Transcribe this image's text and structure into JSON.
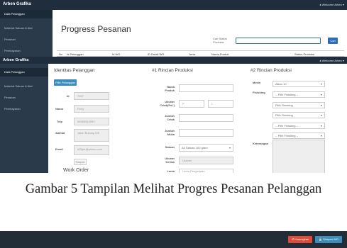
{
  "back": {
    "brand": "Arben Grafika",
    "welcome": "Welcome Arben",
    "sidebar": [
      "Data Pelanggan",
      "Material Satuan & Alat",
      "Pesanan",
      "Pembayaran"
    ],
    "title": "Progress Pesanan",
    "search_label": "Cari Status Produksi",
    "search_value": "",
    "cari": "Cari",
    "columns": [
      "No",
      "Id Pelanggan",
      "Id WO",
      "ID Detail WO",
      "Jenis",
      "Nama Produk",
      "Status Produksi"
    ]
  },
  "front": {
    "brand": "Arben Grafika",
    "welcome": "Welcome Arben",
    "sidebar": [
      "Data Pelanggan",
      "Material Satuan & Alat",
      "Pesanan",
      "Pembayaran"
    ],
    "identitas": {
      "title": "Identitas Pelanggan",
      "pilih": "Pilih Pelanggan",
      "id_label": "Id",
      "id_value": "7927",
      "nama_label": "Nama",
      "nama_value": "Ferry",
      "telp_label": "Telp",
      "telp_value": "08965544093",
      "alamat_label": "Alamat",
      "alamat_value": "Jalan Bukung II/8",
      "email_label": "Email",
      "email_value": "b25ptr@yahoo.com",
      "simpan": "Simpan"
    },
    "work_order": "Work Order",
    "rincian1": {
      "title": "#1 Rincian Produksi",
      "nama_produk": "Nama Produk",
      "ukuran_cetak": "Ukuran Cetak(PxL)",
      "p": "P",
      "l": "L",
      "jumlah_cetak": "Jumlah Cetak",
      "jumlah_muka": "Jumlah Muka",
      "satuan_label": "Satuan",
      "satuan_value": "A4 Satuan 100 gram",
      "ukuran_kertas": "Ukuran Kertas",
      "ukuran_kertas_value": "Ukuran",
      "lama": "Lama",
      "lama_value": "Lama Pengerjaan"
    },
    "rincian2": {
      "title": "#2 Rincian Produksi",
      "mesin_label": "Mesin",
      "mesin_value": "Alkan 10",
      "finishing_label": "Finishing",
      "finishing_options": [
        "-- Pilih Finishing --",
        "Pilih Finishing",
        "Pilih Finishing",
        "-- Pilih Finishing --",
        "-- Pilih Finishing --"
      ],
      "keterangan": "Keterangan"
    },
    "footer": {
      "kosongkan": "Kosongkan",
      "simpan_wo": "Simpan WO"
    }
  },
  "caption": "Gambar 5 Tampilan Melihat Progres Pesanan Pelanggan"
}
